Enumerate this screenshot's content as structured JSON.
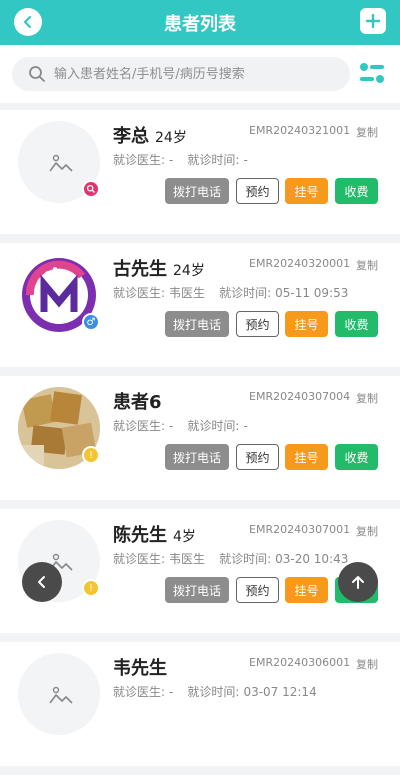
{
  "header": {
    "title": "患者列表",
    "back_icon": "chevron-left-icon",
    "add_icon": "plus-icon"
  },
  "search": {
    "placeholder": "输入患者姓名/手机号/病历号搜索",
    "value": ""
  },
  "colors": {
    "accent": "#33c7c4",
    "call": "#8d8d8d",
    "register": "#f79a1b",
    "pay": "#22bb6a"
  },
  "labels": {
    "doctor": "就诊医生:",
    "time": "就诊时间:",
    "copy": "复制",
    "call": "拨打电话",
    "book": "预约",
    "register": "挂号",
    "pay": "收费"
  },
  "patients": [
    {
      "name": "李总",
      "age": "24岁",
      "emr": "EMR20240321001",
      "doctor": "-",
      "time": "-",
      "avatar": "placeholder-image",
      "badge": "search-icon"
    },
    {
      "name": "古先生",
      "age": "24岁",
      "emr": "EMR20240320001",
      "doctor": "韦医生",
      "time": "05-11 09:53",
      "avatar": "logo-m-image",
      "badge": "male-icon"
    },
    {
      "name": "患者6",
      "age": "",
      "emr": "EMR20240307004",
      "doctor": "-",
      "time": "-",
      "avatar": "photo-image",
      "badge": "info-icon"
    },
    {
      "name": "陈先生",
      "age": "4岁",
      "emr": "EMR20240307001",
      "doctor": "韦医生",
      "time": "03-20 10:43",
      "avatar": "placeholder-image",
      "badge": "info-icon"
    },
    {
      "name": "韦先生",
      "age": "",
      "emr": "EMR20240306001",
      "doctor": "-",
      "time": "03-07 12:14",
      "avatar": "placeholder-image",
      "badge": ""
    }
  ],
  "floating": {
    "back_icon": "chevron-left-icon",
    "top_icon": "arrow-up-icon"
  }
}
